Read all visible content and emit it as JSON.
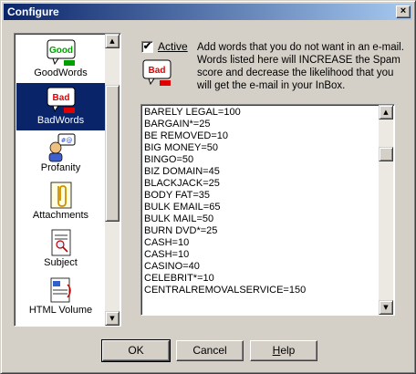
{
  "window": {
    "title": "Configure",
    "close_label": "×"
  },
  "categories": [
    {
      "id": "goodwords",
      "label": "GoodWords",
      "icon": "good-icon"
    },
    {
      "id": "badwords",
      "label": "BadWords",
      "icon": "bad-icon",
      "selected": true
    },
    {
      "id": "profanity",
      "label": "Profanity",
      "icon": "profanity-icon"
    },
    {
      "id": "attachments",
      "label": "Attachments",
      "icon": "paperclip-icon"
    },
    {
      "id": "subject",
      "label": "Subject",
      "icon": "subject-icon"
    },
    {
      "id": "html-volume",
      "label": "HTML Volume",
      "icon": "html-volume-icon"
    }
  ],
  "category_icon_text": {
    "good": "Good",
    "bad": "Bad"
  },
  "active": {
    "label": "Active",
    "checked": true,
    "check_mark": "✔"
  },
  "description": "Add words that you do not want in an e-mail. Words listed here will INCREASE the Spam score and decrease the likelihood that you will get the e-mail in your InBox.",
  "words": [
    "BARELY LEGAL=100",
    "BARGAIN*=25",
    "BE REMOVED=10",
    "BIG MONEY=50",
    "BINGO=50",
    "BIZ DOMAIN=45",
    "BLACKJACK=25",
    "BODY FAT=35",
    "BULK EMAIL=65",
    "BULK MAIL=50",
    "BURN DVD*=25",
    "CASH=10",
    "CASH=10",
    "CASINO=40",
    "CELEBRIT*=10",
    "CENTRALREMOVALSERVICE=150"
  ],
  "scroll_arrows": {
    "up": "▲",
    "down": "▼"
  },
  "buttons": {
    "ok": "OK",
    "cancel": "Cancel",
    "help_underlined": "H",
    "help_rest": "elp"
  },
  "colors": {
    "title_start": "#0a246a",
    "title_end": "#a6caf0",
    "selection": "#0a246a",
    "bad_red": "#e00000",
    "good_green": "#00a000"
  }
}
